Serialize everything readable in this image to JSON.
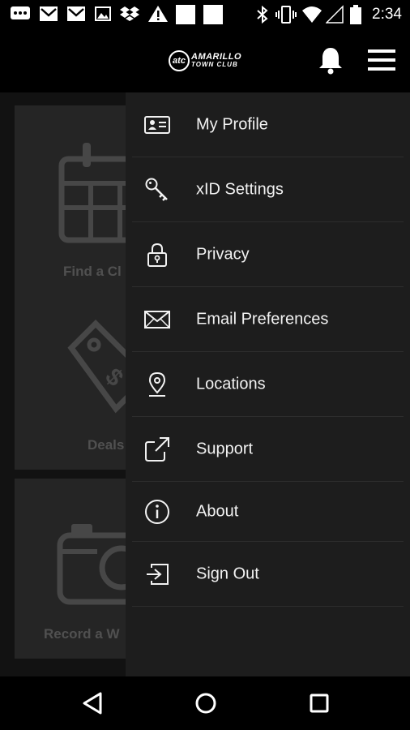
{
  "status_bar": {
    "time": "2:34",
    "icons": [
      "messenger-icon",
      "gmail-icon",
      "gmail-icon",
      "image-icon",
      "dropbox-icon",
      "warning-icon",
      "blank-square-icon",
      "blank-square-icon",
      "bluetooth-icon",
      "vibrate-icon",
      "wifi-icon",
      "signal-icon",
      "battery-icon"
    ]
  },
  "app_bar": {
    "logo_mark": "atc",
    "logo_line1": "AMARILLO",
    "logo_line2": "TOWN CLUB"
  },
  "dashboard": {
    "tiles": [
      {
        "label": "Find a Cl",
        "icon": "calendar-icon"
      },
      {
        "label": "Deals",
        "icon": "price-tag-icon"
      },
      {
        "label": "Record a W",
        "icon": "camera-icon"
      }
    ]
  },
  "drawer": {
    "items": [
      {
        "label": "My Profile",
        "icon": "id-card-icon"
      },
      {
        "label": "xID Settings",
        "icon": "key-icon"
      },
      {
        "label": "Privacy",
        "icon": "lock-icon"
      },
      {
        "label": "Email Preferences",
        "icon": "envelope-icon"
      },
      {
        "label": "Locations",
        "icon": "location-pin-icon"
      },
      {
        "label": "Support",
        "icon": "external-link-icon"
      },
      {
        "label": "About",
        "icon": "info-icon"
      },
      {
        "label": "Sign Out",
        "icon": "sign-out-icon"
      }
    ]
  },
  "colors": {
    "drawer_bg": "#1d1d1d",
    "divider": "#2d2d2d",
    "text": "#f2f2f2"
  }
}
